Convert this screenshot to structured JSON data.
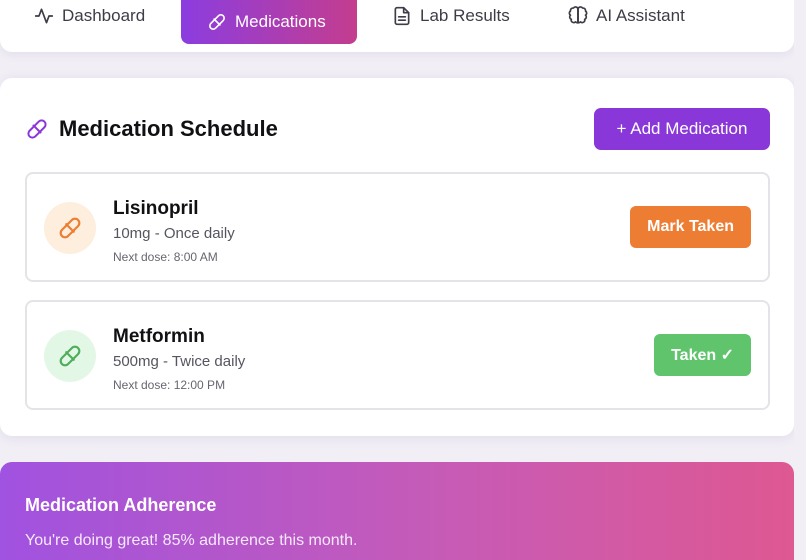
{
  "nav": {
    "tabs": [
      {
        "label": "Dashboard",
        "icon": "activity-icon",
        "active": false
      },
      {
        "label": "Medications",
        "icon": "pill-icon",
        "active": true
      },
      {
        "label": "Lab Results",
        "icon": "document-icon",
        "active": false
      },
      {
        "label": "AI Assistant",
        "icon": "brain-icon",
        "active": false
      }
    ]
  },
  "schedule": {
    "title": "Medication Schedule",
    "add_button": "+ Add Medication",
    "medications": [
      {
        "name": "Lisinopril",
        "dose": "10mg - Once daily",
        "next_dose": "Next dose: 8:00 AM",
        "button": "Mark Taken",
        "color": "#ee7d34"
      },
      {
        "name": "Metformin",
        "dose": "500mg - Twice daily",
        "next_dose": "Next dose: 12:00 PM",
        "button": "Taken ✓",
        "color": "#5fc46c"
      }
    ]
  },
  "adherence": {
    "title": "Medication Adherence",
    "message": "You're doing great! 85% adherence this month."
  },
  "colors": {
    "accent": "#8a37d9",
    "gradient_start": "#8b3de0",
    "gradient_end": "#c43d8e",
    "orange": "#ee7d34",
    "green": "#5fc46c"
  }
}
